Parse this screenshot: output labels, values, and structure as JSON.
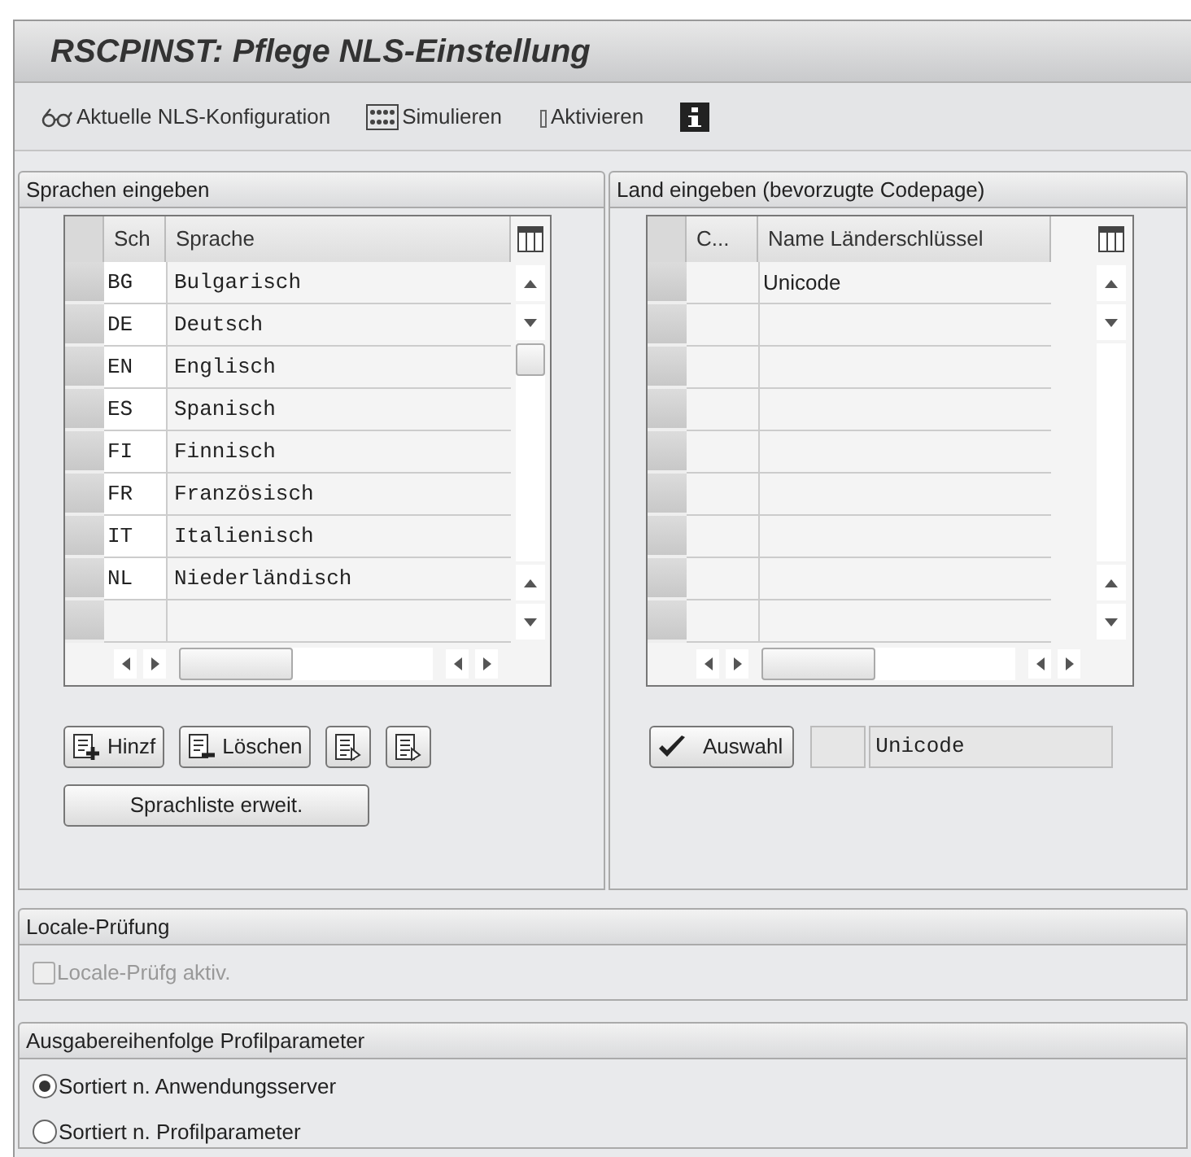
{
  "window": {
    "title": "RSCPINST: Pflege NLS-Einstellung"
  },
  "toolbar": [
    {
      "kind": "glasses",
      "label": "Aktuelle NLS-Konfiguration"
    },
    {
      "kind": "simulate",
      "label": "Simulieren"
    },
    {
      "kind": "activate",
      "label": "Aktivieren"
    },
    {
      "kind": "info"
    }
  ],
  "languages": {
    "title": "Sprachen eingeben",
    "columns": [
      "Sch",
      "Sprache"
    ],
    "rows": [
      {
        "code": "BG",
        "name": "Bulgarisch"
      },
      {
        "code": "DE",
        "name": "Deutsch"
      },
      {
        "code": "EN",
        "name": "Englisch"
      },
      {
        "code": "ES",
        "name": "Spanisch"
      },
      {
        "code": "FI",
        "name": "Finnisch"
      },
      {
        "code": "FR",
        "name": "Französisch"
      },
      {
        "code": "IT",
        "name": "Italienisch"
      },
      {
        "code": "NL",
        "name": "Niederländisch"
      }
    ],
    "buttons": [
      {
        "kind": "add",
        "label": "Hinzf"
      },
      {
        "kind": "delete",
        "label": "Löschen"
      },
      {
        "kind": "export"
      },
      {
        "kind": "export"
      }
    ],
    "extend_button": "Sprachliste erweit."
  },
  "country": {
    "title": "Land eingeben (bevorzugte Codepage)",
    "columns": [
      "C...",
      "Name Länderschlüssel"
    ],
    "rows": [
      {
        "name": "Unicode"
      }
    ],
    "select_button": "Auswahl",
    "value": "Unicode"
  },
  "locale": {
    "title": "Locale-Prüfung",
    "checkbox": {
      "label": "Locale-Prüfg aktiv.",
      "checked": false,
      "disabled": true
    }
  },
  "profile": {
    "title": "Ausgabereihenfolge Profilparameter",
    "options": [
      {
        "label": "Sortiert n. Anwendungsserver",
        "selected": true
      },
      {
        "label": "Sortiert n. Profilparameter",
        "selected": false
      }
    ]
  }
}
